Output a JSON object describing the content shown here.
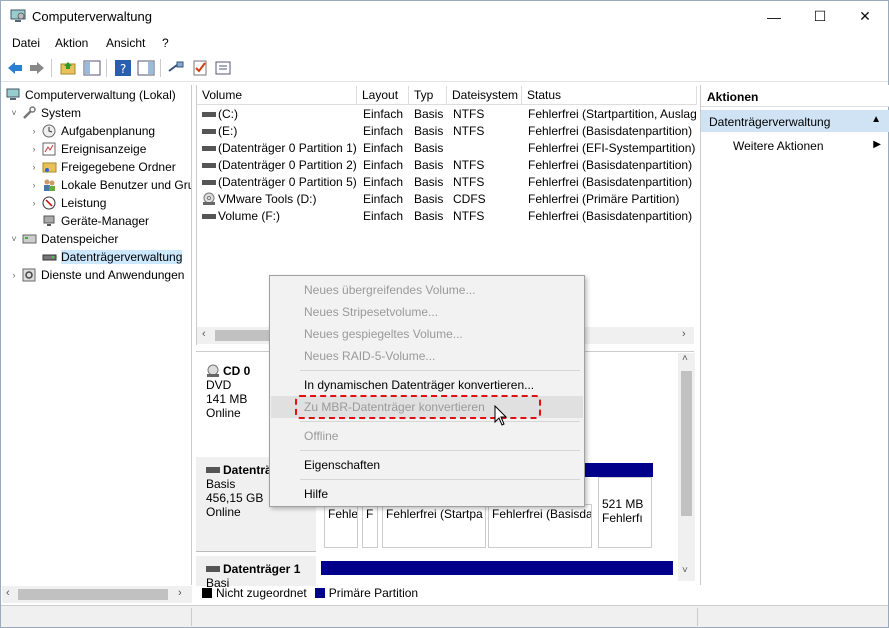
{
  "window": {
    "title": "Computerverwaltung",
    "controls": {
      "minimize": "—",
      "maximize": "☐",
      "close": "✕"
    }
  },
  "menu": [
    "Datei",
    "Aktion",
    "Ansicht",
    "?"
  ],
  "tree": {
    "items": [
      {
        "label": "Computerverwaltung (Lokal)",
        "arrow": "",
        "icon": "computer-management-icon"
      },
      {
        "label": "System",
        "arrow": "˅",
        "icon": "tools-icon"
      },
      {
        "label": "Aufgabenplanung",
        "arrow": "›",
        "icon": "clock-icon"
      },
      {
        "label": "Ereignisanzeige",
        "arrow": "›",
        "icon": "event-viewer-icon"
      },
      {
        "label": "Freigegebene Ordner",
        "arrow": "›",
        "icon": "shared-folder-icon"
      },
      {
        "label": "Lokale Benutzer und Gruppen",
        "arrow": "›",
        "icon": "users-icon"
      },
      {
        "label": "Leistung",
        "arrow": "›",
        "icon": "performance-icon"
      },
      {
        "label": "Geräte-Manager",
        "arrow": "",
        "icon": "device-manager-icon"
      },
      {
        "label": "Datenspeicher",
        "arrow": "˅",
        "icon": "storage-icon"
      },
      {
        "label": "Datenträgerverwaltung",
        "arrow": "",
        "icon": "disk-management-icon"
      },
      {
        "label": "Dienste und Anwendungen",
        "arrow": "›",
        "icon": "services-icon"
      }
    ]
  },
  "volumes": {
    "columns": [
      "Volume",
      "Layout",
      "Typ",
      "Dateisystem",
      "Status"
    ],
    "rows": [
      {
        "volume": "(C:)",
        "layout": "Einfach",
        "typ": "Basis",
        "fs": "NTFS",
        "status": "Fehlerfrei (Startpartition, Auslag"
      },
      {
        "volume": "(E:)",
        "layout": "Einfach",
        "typ": "Basis",
        "fs": "NTFS",
        "status": "Fehlerfrei (Basisdatenpartition)"
      },
      {
        "volume": "(Datenträger 0 Partition 1)",
        "layout": "Einfach",
        "typ": "Basis",
        "fs": "",
        "status": "Fehlerfrei (EFI-Systempartition)"
      },
      {
        "volume": "(Datenträger 0 Partition 2)",
        "layout": "Einfach",
        "typ": "Basis",
        "fs": "NTFS",
        "status": "Fehlerfrei (Basisdatenpartition)"
      },
      {
        "volume": "(Datenträger 0 Partition 5)",
        "layout": "Einfach",
        "typ": "Basis",
        "fs": "NTFS",
        "status": "Fehlerfrei (Basisdatenpartition)"
      },
      {
        "volume": "VMware Tools (D:)",
        "layout": "Einfach",
        "typ": "Basis",
        "fs": "CDFS",
        "status": "Fehlerfrei (Primäre Partition)"
      },
      {
        "volume": "Volume (F:)",
        "layout": "Einfach",
        "typ": "Basis",
        "fs": "NTFS",
        "status": "Fehlerfrei (Basisdatenpartition)"
      }
    ]
  },
  "disks": {
    "cd0": {
      "name": "CD 0",
      "type": "DVD",
      "size": "141 MB",
      "state": "Online"
    },
    "disk0": {
      "name": "Datenträ",
      "type": "Basis",
      "size": "456,15 GB",
      "state": "Online"
    },
    "disk1": {
      "name": "Datenträger 1",
      "type": "Basi"
    },
    "partitions": [
      {
        "line1": "Fehle",
        "line2": ""
      },
      {
        "line1": "F",
        "line2": ""
      },
      {
        "line1": "Fehlerfrei (Startpa",
        "line2": ""
      },
      {
        "line1": "Fehlerfrei (Basisda",
        "line2": ""
      },
      {
        "line1": "521 MB",
        "line2": "Fehlerfı"
      }
    ]
  },
  "legend": [
    {
      "label": "Nicht zugeordnet",
      "color": "#000000"
    },
    {
      "label": "Primäre Partition",
      "color": "#00008b"
    }
  ],
  "actions": {
    "title": "Aktionen",
    "section": "Datenträgerverwaltung",
    "item": "Weitere Aktionen"
  },
  "context_menu": {
    "items": [
      {
        "label": "Neues übergreifendes Volume...",
        "disabled": true
      },
      {
        "label": "Neues Stripesetvolume...",
        "disabled": true
      },
      {
        "label": "Neues gespiegeltes Volume...",
        "disabled": true
      },
      {
        "label": "Neues RAID-5-Volume...",
        "disabled": true
      },
      {
        "label": "In dynamischen Datenträger konvertieren...",
        "disabled": false
      },
      {
        "label": "Zu MBR-Datenträger konvertieren",
        "disabled": true
      },
      {
        "label": "Offline",
        "disabled": true
      },
      {
        "label": "Eigenschaften",
        "disabled": false
      },
      {
        "label": "Hilfe",
        "disabled": false
      }
    ]
  },
  "colors": {
    "highlight": "#e01010",
    "partition": "#00008b",
    "selection": "#cce8ff"
  }
}
